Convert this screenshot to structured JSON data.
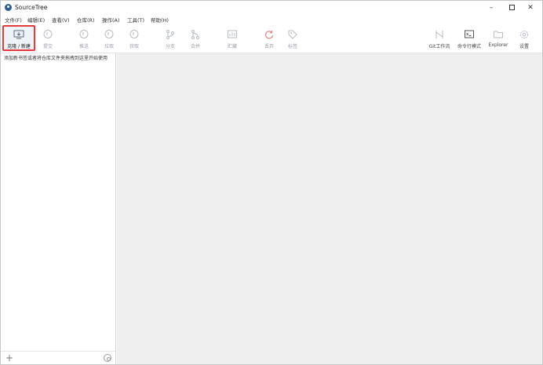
{
  "window": {
    "title": "SourceTree"
  },
  "title_controls": {
    "minimize": "–",
    "close": "✕"
  },
  "menu": [
    {
      "label": "文件(F)"
    },
    {
      "label": "编辑(E)"
    },
    {
      "label": "查看(V)"
    },
    {
      "label": "仓库(R)"
    },
    {
      "label": "操作(A)"
    },
    {
      "label": "工具(T)"
    },
    {
      "label": "帮助(H)"
    }
  ],
  "toolbar": {
    "clone": "克隆 / 新建",
    "commit": "提交",
    "push": "推送",
    "pull": "拉取",
    "fetch": "获取",
    "branch": "分支",
    "merge": "合并",
    "stash": "贮藏",
    "discard": "丢弃",
    "tag": "标签",
    "gitflow": "Git工作流",
    "terminal": "命令行模式",
    "explorer": "Explorer",
    "settings": "设置"
  },
  "sidebar": {
    "hint": "添加新书签或者将仓库文件夹拖拽到这里开始使用",
    "add": "+"
  },
  "colors": {
    "active_border": "#e03c3c",
    "main_bg": "#f0f0f0"
  }
}
